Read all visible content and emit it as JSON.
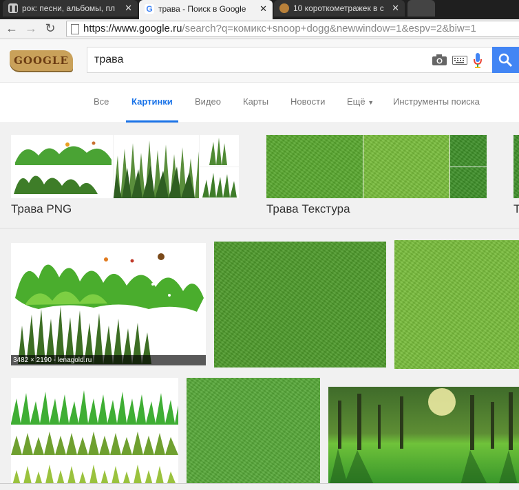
{
  "browser": {
    "tabs": [
      {
        "title": "рок: песни, альбомы, пл",
        "favicon": "pause-icon"
      },
      {
        "title": "трава - Поиск в Google",
        "favicon": "google-g-icon",
        "active": true
      },
      {
        "title": "10 короткометражек в с",
        "favicon": "cookie-icon"
      }
    ],
    "url_domain": "https://www.google.ru",
    "url_rest": "/search?q=комикс+snoop+dogg&newwindow=1&espv=2&biw=1"
  },
  "google": {
    "logo_text": "GOOGLE",
    "query": "трава",
    "menu": [
      "Все",
      "Картинки",
      "Видео",
      "Карты",
      "Новости",
      "Ещё",
      "Инструменты поиска"
    ],
    "active_menu": "Картинки"
  },
  "collections": [
    {
      "label": "Трава PNG"
    },
    {
      "label": "Трава Текстура"
    },
    {
      "label": "Т"
    }
  ],
  "results": [
    {
      "caption": "3482 × 2190 - lenagold.ru"
    }
  ],
  "colors": {
    "accent": "#1a73e8",
    "search_button": "#4285f4"
  }
}
